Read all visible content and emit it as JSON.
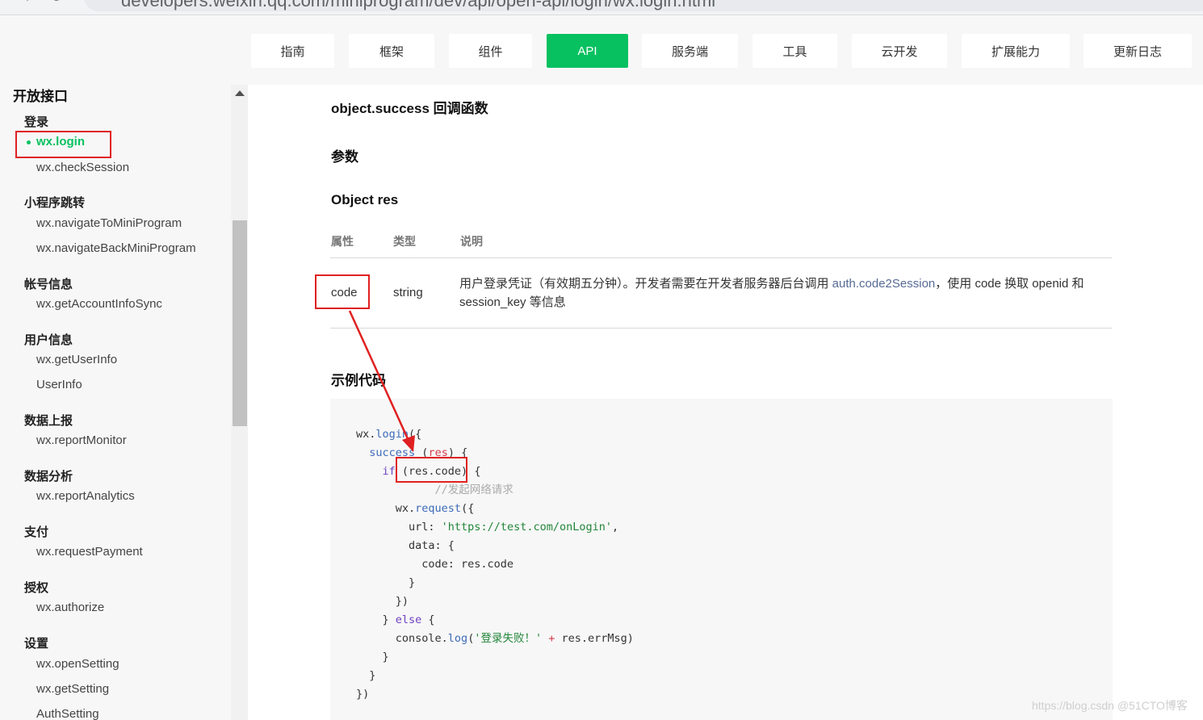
{
  "browser": {
    "url": "developers.weixin.qq.com/miniprogram/dev/api/open-api/login/wx.login.html"
  },
  "topnav": {
    "tabs": [
      {
        "label": "指南"
      },
      {
        "label": "框架"
      },
      {
        "label": "组件"
      },
      {
        "label": "API",
        "active": true
      },
      {
        "label": "服务端"
      },
      {
        "label": "工具"
      },
      {
        "label": "云开发"
      },
      {
        "label": "扩展能力"
      },
      {
        "label": "更新日志"
      }
    ],
    "active_color": "#07c160"
  },
  "sidebar": {
    "section_title": "开放接口",
    "groups": [
      {
        "title": "登录",
        "items": [
          "wx.login",
          "wx.checkSession"
        ]
      },
      {
        "title": "小程序跳转",
        "items": [
          "wx.navigateToMiniProgram",
          "wx.navigateBackMiniProgram"
        ]
      },
      {
        "title": "帐号信息",
        "items": [
          "wx.getAccountInfoSync"
        ]
      },
      {
        "title": "用户信息",
        "items": [
          "wx.getUserInfo",
          "UserInfo"
        ]
      },
      {
        "title": "数据上报",
        "items": [
          "wx.reportMonitor"
        ]
      },
      {
        "title": "数据分析",
        "items": [
          "wx.reportAnalytics"
        ]
      },
      {
        "title": "支付",
        "items": [
          "wx.requestPayment"
        ]
      },
      {
        "title": "授权",
        "items": [
          "wx.authorize"
        ]
      },
      {
        "title": "设置",
        "items": [
          "wx.openSetting",
          "wx.getSetting",
          "AuthSetting"
        ]
      }
    ],
    "active_item": "wx.login"
  },
  "main": {
    "callback_heading": "object.success 回调函数",
    "params_heading": "参数",
    "object_heading": "Object res",
    "table": {
      "headers": [
        "属性",
        "类型",
        "说明"
      ],
      "rows": [
        {
          "prop": "code",
          "type": "string",
          "desc_before": "用户登录凭证（有效期五分钟）。开发者需要在开发者服务器后台调用 ",
          "desc_link": "auth.code2Session",
          "desc_after": "，使用 code 换取 openid 和 session_key 等信息"
        }
      ]
    },
    "example_heading": "示例代码",
    "code_lines": [
      "wx.login({",
      "  success (res) {",
      "    if (res.code) {",
      "      //发起网络请求",
      "      wx.request({",
      "        url: 'https://test.com/onLogin',",
      "        data: {",
      "          code: res.code",
      "        }",
      "      })",
      "    } else {",
      "      console.log('登录失败！' + res.errMsg)",
      "    }",
      "  }",
      "})"
    ]
  },
  "watermark": "https://blog.csdn @51CTO博客",
  "annotation_color": "#e02020"
}
